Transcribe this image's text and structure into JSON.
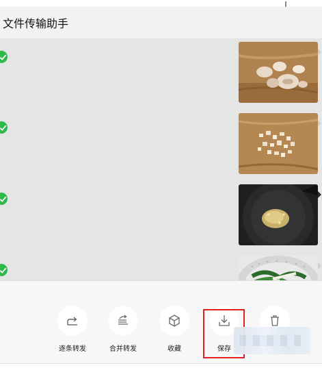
{
  "header": {
    "title": "文件传输助手"
  },
  "messages": [
    {
      "image": "image-message-garlic-cloves",
      "selected": true
    },
    {
      "image": "image-message-chopped-garlic",
      "selected": true
    },
    {
      "image": "image-message-garlic-in-pan",
      "selected": true
    },
    {
      "image": "image-message-greens-in-colander",
      "selected": true
    }
  ],
  "actions": {
    "forward_one_by_one": {
      "label": "逐条转发",
      "icon": "forward-icon"
    },
    "merge_forward": {
      "label": "合并转发",
      "icon": "merge-forward-icon"
    },
    "favorite": {
      "label": "收藏",
      "icon": "cube-icon"
    },
    "save": {
      "label": "保存",
      "icon": "download-icon"
    },
    "delete": {
      "icon": "trash-icon"
    }
  },
  "colors": {
    "check": "#2db84a",
    "highlight": "#e02020",
    "chat_bg": "#e5e5e5"
  }
}
